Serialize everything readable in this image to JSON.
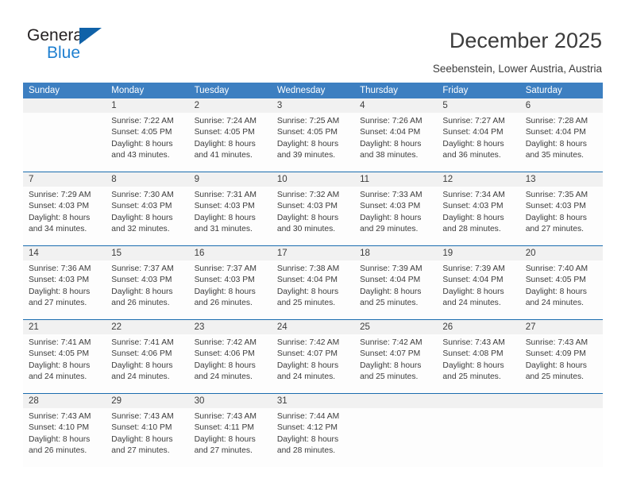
{
  "brand": {
    "name_top": "General",
    "name_bottom": "Blue",
    "triangle_color": "#1062a8",
    "blue_text_color": "#1e7fd0",
    "logo_icon": "general-blue-triangle-logo"
  },
  "header": {
    "title": "December 2025",
    "subtitle": "Seebenstein, Lower Austria, Austria"
  },
  "theme": {
    "header_blue": "#3d7fc1",
    "week_rule_blue": "#1b6daf",
    "daynum_band": "#f1f1f1",
    "text": "#3c3c3c"
  },
  "calendar": {
    "weekdays": [
      "Sunday",
      "Monday",
      "Tuesday",
      "Wednesday",
      "Thursday",
      "Friday",
      "Saturday"
    ],
    "weeks": [
      {
        "days": [
          {
            "num": "",
            "sunrise": "",
            "sunset": "",
            "daylight_1": "",
            "daylight_2": ""
          },
          {
            "num": "1",
            "sunrise": "Sunrise: 7:22 AM",
            "sunset": "Sunset: 4:05 PM",
            "daylight_1": "Daylight: 8 hours",
            "daylight_2": "and 43 minutes."
          },
          {
            "num": "2",
            "sunrise": "Sunrise: 7:24 AM",
            "sunset": "Sunset: 4:05 PM",
            "daylight_1": "Daylight: 8 hours",
            "daylight_2": "and 41 minutes."
          },
          {
            "num": "3",
            "sunrise": "Sunrise: 7:25 AM",
            "sunset": "Sunset: 4:05 PM",
            "daylight_1": "Daylight: 8 hours",
            "daylight_2": "and 39 minutes."
          },
          {
            "num": "4",
            "sunrise": "Sunrise: 7:26 AM",
            "sunset": "Sunset: 4:04 PM",
            "daylight_1": "Daylight: 8 hours",
            "daylight_2": "and 38 minutes."
          },
          {
            "num": "5",
            "sunrise": "Sunrise: 7:27 AM",
            "sunset": "Sunset: 4:04 PM",
            "daylight_1": "Daylight: 8 hours",
            "daylight_2": "and 36 minutes."
          },
          {
            "num": "6",
            "sunrise": "Sunrise: 7:28 AM",
            "sunset": "Sunset: 4:04 PM",
            "daylight_1": "Daylight: 8 hours",
            "daylight_2": "and 35 minutes."
          }
        ]
      },
      {
        "days": [
          {
            "num": "7",
            "sunrise": "Sunrise: 7:29 AM",
            "sunset": "Sunset: 4:03 PM",
            "daylight_1": "Daylight: 8 hours",
            "daylight_2": "and 34 minutes."
          },
          {
            "num": "8",
            "sunrise": "Sunrise: 7:30 AM",
            "sunset": "Sunset: 4:03 PM",
            "daylight_1": "Daylight: 8 hours",
            "daylight_2": "and 32 minutes."
          },
          {
            "num": "9",
            "sunrise": "Sunrise: 7:31 AM",
            "sunset": "Sunset: 4:03 PM",
            "daylight_1": "Daylight: 8 hours",
            "daylight_2": "and 31 minutes."
          },
          {
            "num": "10",
            "sunrise": "Sunrise: 7:32 AM",
            "sunset": "Sunset: 4:03 PM",
            "daylight_1": "Daylight: 8 hours",
            "daylight_2": "and 30 minutes."
          },
          {
            "num": "11",
            "sunrise": "Sunrise: 7:33 AM",
            "sunset": "Sunset: 4:03 PM",
            "daylight_1": "Daylight: 8 hours",
            "daylight_2": "and 29 minutes."
          },
          {
            "num": "12",
            "sunrise": "Sunrise: 7:34 AM",
            "sunset": "Sunset: 4:03 PM",
            "daylight_1": "Daylight: 8 hours",
            "daylight_2": "and 28 minutes."
          },
          {
            "num": "13",
            "sunrise": "Sunrise: 7:35 AM",
            "sunset": "Sunset: 4:03 PM",
            "daylight_1": "Daylight: 8 hours",
            "daylight_2": "and 27 minutes."
          }
        ]
      },
      {
        "days": [
          {
            "num": "14",
            "sunrise": "Sunrise: 7:36 AM",
            "sunset": "Sunset: 4:03 PM",
            "daylight_1": "Daylight: 8 hours",
            "daylight_2": "and 27 minutes."
          },
          {
            "num": "15",
            "sunrise": "Sunrise: 7:37 AM",
            "sunset": "Sunset: 4:03 PM",
            "daylight_1": "Daylight: 8 hours",
            "daylight_2": "and 26 minutes."
          },
          {
            "num": "16",
            "sunrise": "Sunrise: 7:37 AM",
            "sunset": "Sunset: 4:03 PM",
            "daylight_1": "Daylight: 8 hours",
            "daylight_2": "and 26 minutes."
          },
          {
            "num": "17",
            "sunrise": "Sunrise: 7:38 AM",
            "sunset": "Sunset: 4:04 PM",
            "daylight_1": "Daylight: 8 hours",
            "daylight_2": "and 25 minutes."
          },
          {
            "num": "18",
            "sunrise": "Sunrise: 7:39 AM",
            "sunset": "Sunset: 4:04 PM",
            "daylight_1": "Daylight: 8 hours",
            "daylight_2": "and 25 minutes."
          },
          {
            "num": "19",
            "sunrise": "Sunrise: 7:39 AM",
            "sunset": "Sunset: 4:04 PM",
            "daylight_1": "Daylight: 8 hours",
            "daylight_2": "and 24 minutes."
          },
          {
            "num": "20",
            "sunrise": "Sunrise: 7:40 AM",
            "sunset": "Sunset: 4:05 PM",
            "daylight_1": "Daylight: 8 hours",
            "daylight_2": "and 24 minutes."
          }
        ]
      },
      {
        "days": [
          {
            "num": "21",
            "sunrise": "Sunrise: 7:41 AM",
            "sunset": "Sunset: 4:05 PM",
            "daylight_1": "Daylight: 8 hours",
            "daylight_2": "and 24 minutes."
          },
          {
            "num": "22",
            "sunrise": "Sunrise: 7:41 AM",
            "sunset": "Sunset: 4:06 PM",
            "daylight_1": "Daylight: 8 hours",
            "daylight_2": "and 24 minutes."
          },
          {
            "num": "23",
            "sunrise": "Sunrise: 7:42 AM",
            "sunset": "Sunset: 4:06 PM",
            "daylight_1": "Daylight: 8 hours",
            "daylight_2": "and 24 minutes."
          },
          {
            "num": "24",
            "sunrise": "Sunrise: 7:42 AM",
            "sunset": "Sunset: 4:07 PM",
            "daylight_1": "Daylight: 8 hours",
            "daylight_2": "and 24 minutes."
          },
          {
            "num": "25",
            "sunrise": "Sunrise: 7:42 AM",
            "sunset": "Sunset: 4:07 PM",
            "daylight_1": "Daylight: 8 hours",
            "daylight_2": "and 25 minutes."
          },
          {
            "num": "26",
            "sunrise": "Sunrise: 7:43 AM",
            "sunset": "Sunset: 4:08 PM",
            "daylight_1": "Daylight: 8 hours",
            "daylight_2": "and 25 minutes."
          },
          {
            "num": "27",
            "sunrise": "Sunrise: 7:43 AM",
            "sunset": "Sunset: 4:09 PM",
            "daylight_1": "Daylight: 8 hours",
            "daylight_2": "and 25 minutes."
          }
        ]
      },
      {
        "days": [
          {
            "num": "28",
            "sunrise": "Sunrise: 7:43 AM",
            "sunset": "Sunset: 4:10 PM",
            "daylight_1": "Daylight: 8 hours",
            "daylight_2": "and 26 minutes."
          },
          {
            "num": "29",
            "sunrise": "Sunrise: 7:43 AM",
            "sunset": "Sunset: 4:10 PM",
            "daylight_1": "Daylight: 8 hours",
            "daylight_2": "and 27 minutes."
          },
          {
            "num": "30",
            "sunrise": "Sunrise: 7:43 AM",
            "sunset": "Sunset: 4:11 PM",
            "daylight_1": "Daylight: 8 hours",
            "daylight_2": "and 27 minutes."
          },
          {
            "num": "31",
            "sunrise": "Sunrise: 7:44 AM",
            "sunset": "Sunset: 4:12 PM",
            "daylight_1": "Daylight: 8 hours",
            "daylight_2": "and 28 minutes."
          },
          {
            "num": "",
            "sunrise": "",
            "sunset": "",
            "daylight_1": "",
            "daylight_2": ""
          },
          {
            "num": "",
            "sunrise": "",
            "sunset": "",
            "daylight_1": "",
            "daylight_2": ""
          },
          {
            "num": "",
            "sunrise": "",
            "sunset": "",
            "daylight_1": "",
            "daylight_2": ""
          }
        ]
      }
    ]
  }
}
